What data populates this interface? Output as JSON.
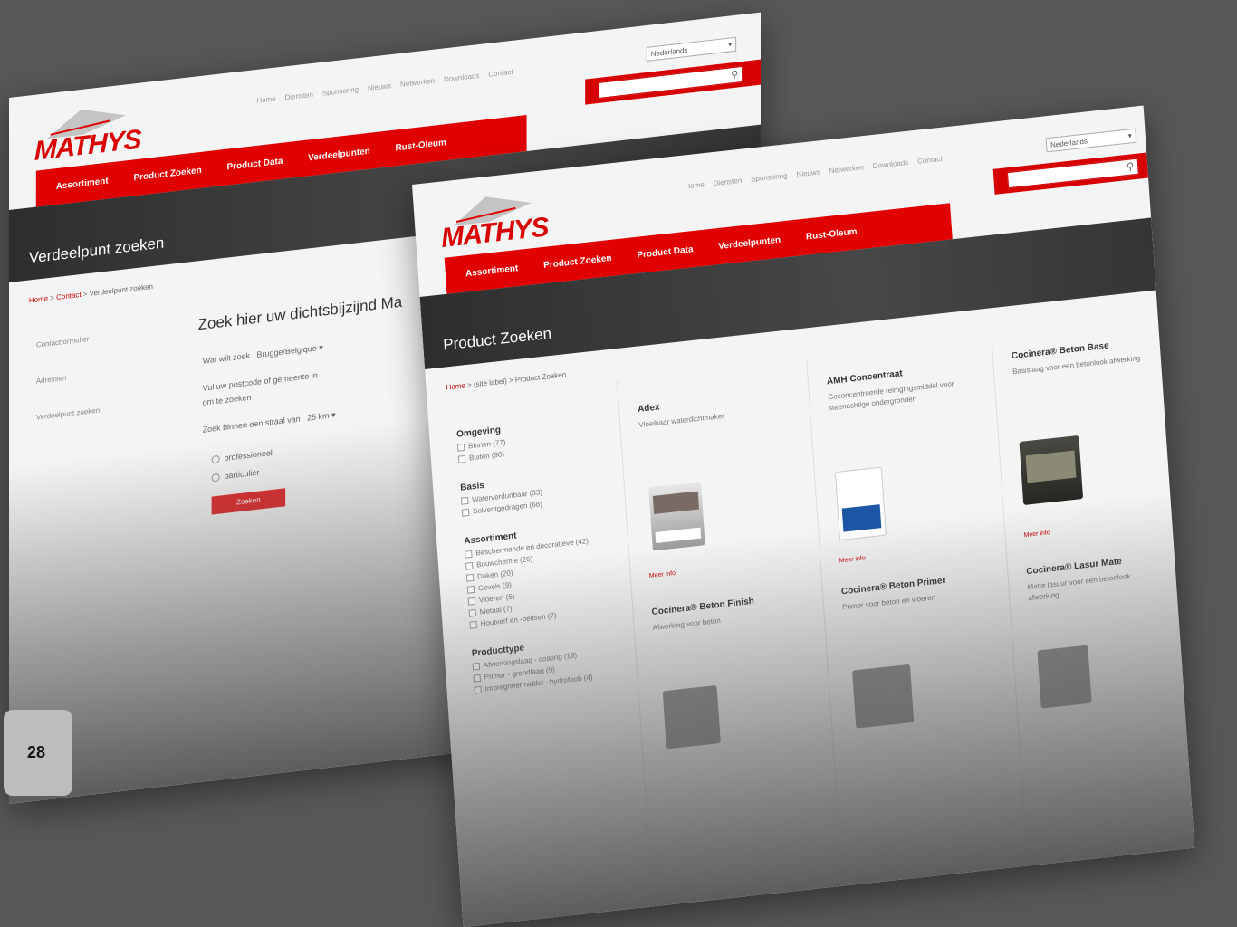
{
  "brand": {
    "name": "MATHYS",
    "accent": "#e00000",
    "banner_bg": "#3a3a3a",
    "page_bg": "#585858"
  },
  "top_nav": [
    "Home",
    "Diensten",
    "Sponsoring",
    "Nieuws",
    "Netwerken",
    "Downloads",
    "Contact"
  ],
  "language": "Nederlands",
  "main_nav": [
    "Assortiment",
    "Product Zoeken",
    "Product Data",
    "Verdeelpunten",
    "Rust-Oleum"
  ],
  "back_page": {
    "banner_title": "Verdeelpunt zoeken",
    "breadcrumb": {
      "home": "Home",
      "sep1": " > ",
      "contact": "Contact",
      "sep2": " > ",
      "current": "Verdeelpunt zoeken"
    },
    "sidebar": [
      "Contactformulier",
      "Adressen",
      "Verdeelpunt zoeken"
    ],
    "heading": "Zoek hier uw dichtsbijzijnd Ma",
    "form": {
      "row1_label": "Wat wilt zoek",
      "row1_value": "Brugge/Belgique",
      "row2_label": "Vul uw postcode of gemeente in",
      "row2_sub": "om te zoeken",
      "row3_label": "Zoek binnen een straal van",
      "row3_value": "25 km",
      "radio1": "professioneel",
      "radio2": "particulier",
      "button": "Zoeken"
    }
  },
  "front_page": {
    "banner_title": "Product Zoeken",
    "breadcrumb": {
      "home": "Home",
      "sep1": " > ",
      "section": "(site label)",
      "sep2": " > ",
      "current": "Product Zoeken"
    },
    "filters": [
      {
        "title": "Omgeving",
        "items": [
          "Binnen (77)",
          "Buiten (90)"
        ]
      },
      {
        "title": "Basis",
        "items": [
          "Waterverdunbaar (33)",
          "Solventgedragen (68)"
        ]
      },
      {
        "title": "Assortiment",
        "items": [
          "Beschermende en decoratieve (42)",
          "Bouwchemie (26)",
          "Daken (20)",
          "Gevels (9)",
          "Vloeren (6)",
          "Metaal (7)",
          "Houtverf en -beitsen (7)"
        ]
      },
      {
        "title": "Producttype",
        "items": [
          "Afwerkingslaag - coating (18)",
          "Primer - grondlaag (9)",
          "Impregneermiddel - hydrofoob (4)"
        ]
      }
    ],
    "products": [
      [
        {
          "name": "Adex",
          "desc": "Vloeibaar waterdichtmaker",
          "more": "Meer info"
        },
        {
          "name": "Cocinera® Beton Finish",
          "desc": "Afwerking voor beton",
          "more": ""
        }
      ],
      [
        {
          "name": "AMH Concentraat",
          "desc": "Geconcentreerde reinigingsmiddel voor steenachtige ondergronden",
          "more": "Meer info"
        },
        {
          "name": "Cocinera® Beton Primer",
          "desc": "Primer voor beton en vloeren",
          "more": ""
        }
      ],
      [
        {
          "name": "Cocinera® Beton Base",
          "desc": "Basislaag voor een betonlook afwerking",
          "more": "Meer info"
        },
        {
          "name": "Cocinera® Lasur Mate",
          "desc": "Matte lasuur voor een betonlook afwerking",
          "more": ""
        }
      ]
    ]
  },
  "page_number": "28"
}
